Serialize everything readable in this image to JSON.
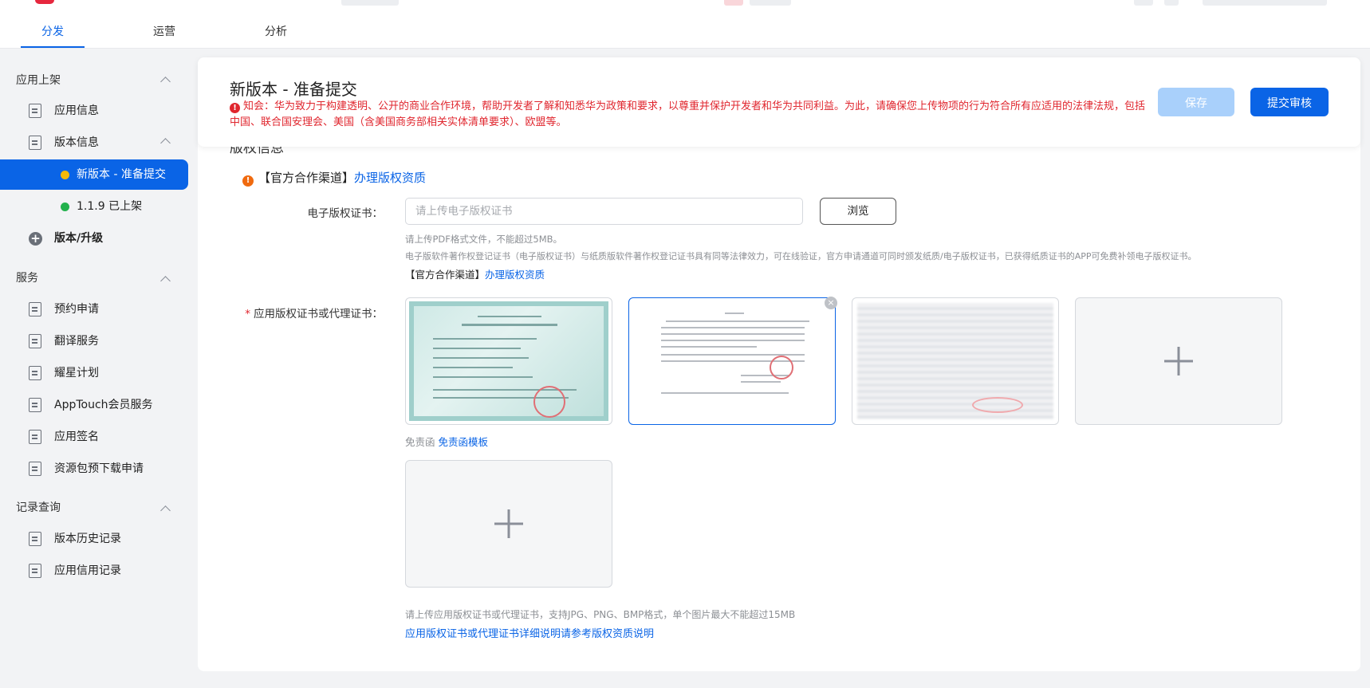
{
  "tabs": [
    "分发",
    "运营",
    "分析"
  ],
  "sidebar": {
    "section_app_listing": "应用上架",
    "item_app_info": "应用信息",
    "item_version_info": "版本信息",
    "item_new_version": "新版本 - 准备提交",
    "item_released": "1.1.9 已上架",
    "item_upgrade": "版本/升级",
    "section_services": "服务",
    "services": [
      "预约申请",
      "翻译服务",
      "耀星计划",
      "AppTouch会员服务",
      "应用签名",
      "资源包预下载申请"
    ],
    "section_records": "记录查询",
    "records": [
      "版本历史记录",
      "应用信用记录"
    ]
  },
  "header": {
    "title": "新版本 - 准备提交",
    "notice": "知会：华为致力于构建透明、公开的商业合作环境，帮助开发者了解和知悉华为政策和要求，以尊重并保护开发者和华为共同利益。为此，请确保您上传物项的行为符合所有应适用的法律法规，包括中国、联合国安理会、美国（含美国商务部相关实体清单要求）、欧盟等。",
    "save_label": "保存",
    "submit_label": "提交审核"
  },
  "section_title": "版权信息",
  "official_channel": {
    "prefix": "【官方合作渠道】",
    "link": "办理版权资质"
  },
  "ecert": {
    "label": "电子版权证书：",
    "placeholder": "请上传电子版权证书",
    "browse_label": "浏览",
    "hint1": "请上传PDF格式文件，不能超过5MB。",
    "hint2": "电子版软件著作权登记证书（电子版权证书）与纸质版软件著作权登记证书具有同等法律效力，可在线验证，官方申请通道可同时颁发纸质/电子版权证书，已获得纸质证书的APP可免费补领电子版权证书。",
    "channel_prefix": "【官方合作渠道】",
    "channel_link": "办理版权资质"
  },
  "app_cert": {
    "required_mark": "*",
    "label": "应用版权证书或代理证书：",
    "disclaimer_prefix": "免责函",
    "disclaimer_link": "免责函模板",
    "hint": "请上传应用版权证书或代理证书，支持JPG、PNG、BMP格式，单个图片最大不能超过15MB",
    "detail_link": "应用版权证书或代理证书详细说明请参考版权资质说明"
  },
  "colors": {
    "accent": "#0a64e6",
    "warning_red": "#e0262e",
    "status_pending": "#f5b90a",
    "status_released": "#22b14c",
    "orange_warning": "#f06a0f"
  },
  "icons": {
    "notice": "error-circle-icon",
    "official": "warning-circle-icon",
    "close": "close-icon",
    "add": "plus-icon"
  }
}
